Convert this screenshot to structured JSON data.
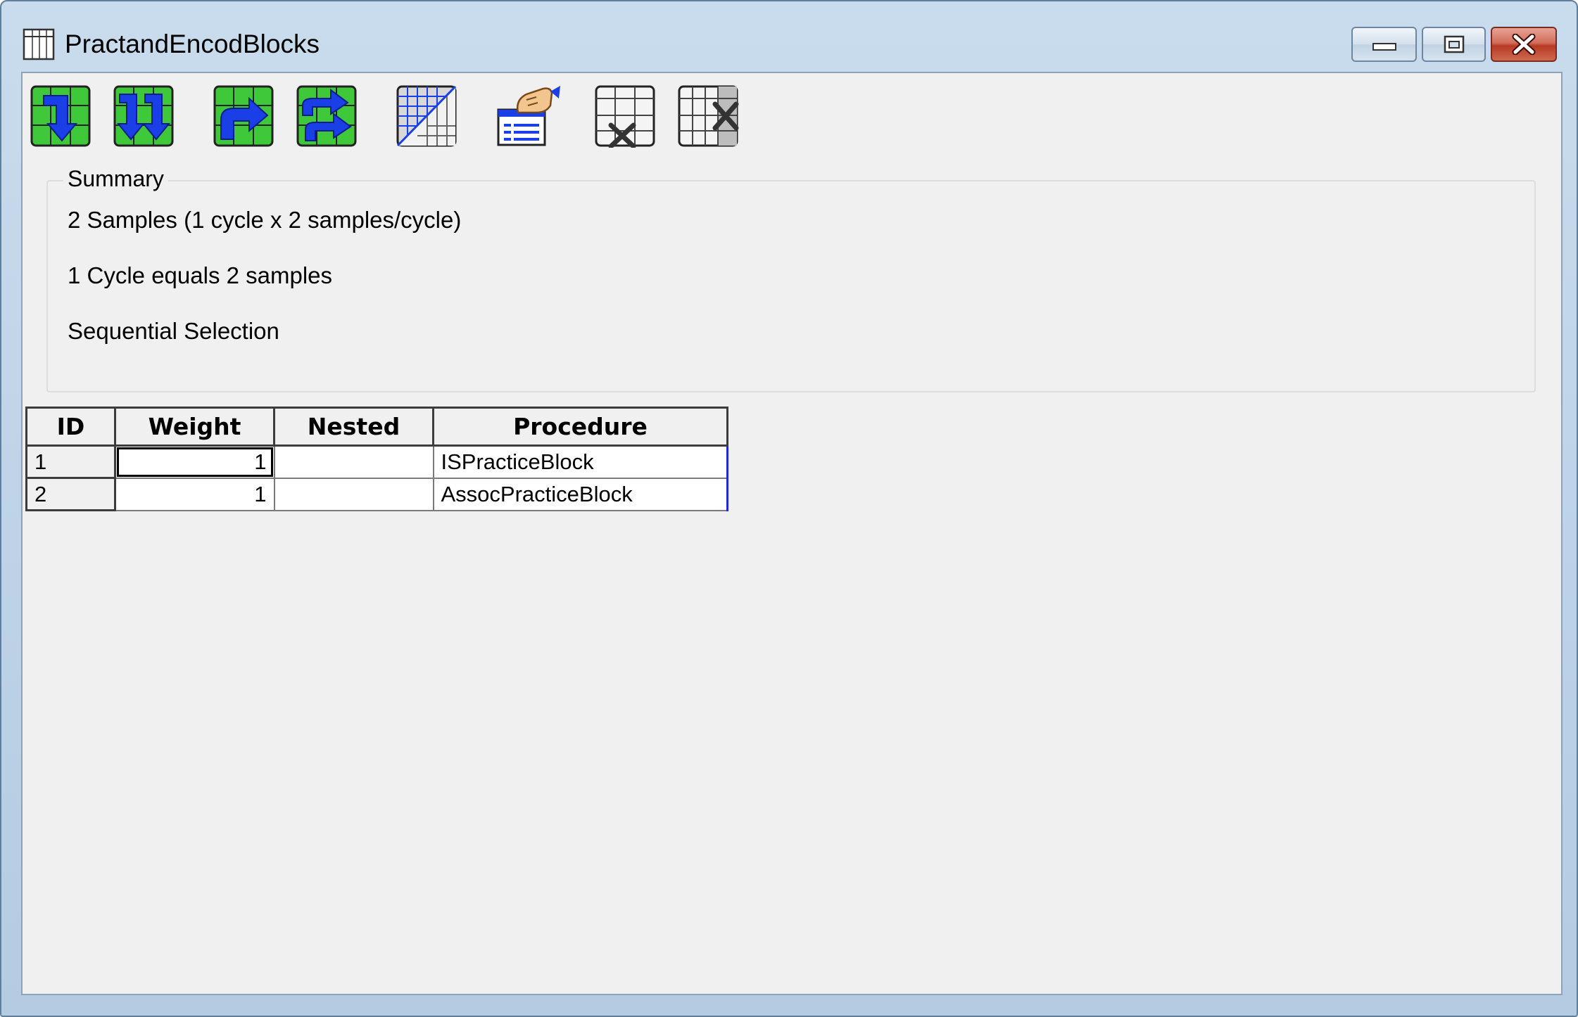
{
  "window": {
    "title": "PractandEncodBlocks",
    "icon": "grid-table-icon",
    "controls": [
      "minimize-icon",
      "restore-icon",
      "close-icon"
    ]
  },
  "toolbar": {
    "buttons": [
      {
        "name": "insert-attribute-before-icon"
      },
      {
        "name": "insert-multiple-attributes-before-icon"
      },
      {
        "name": "insert-attribute-after-icon"
      },
      {
        "name": "insert-multiple-attributes-after-icon"
      },
      {
        "name": "edit-grid-icon"
      },
      {
        "name": "properties-hand-icon"
      },
      {
        "name": "remove-attribute-icon"
      },
      {
        "name": "delete-attribute-icon"
      }
    ]
  },
  "summary": {
    "legend": "Summary",
    "line1": "2 Samples (1 cycle x 2 samples/cycle)",
    "line2": "1 Cycle equals 2 samples",
    "line3": "Sequential Selection"
  },
  "grid": {
    "columns": [
      "ID",
      "Weight",
      "Nested",
      "Procedure"
    ],
    "rows": [
      {
        "id": "1",
        "weight": "1",
        "nested": "",
        "procedure": "ISPracticeBlock"
      },
      {
        "id": "2",
        "weight": "1",
        "nested": "",
        "procedure": "AssocPracticeBlock"
      }
    ]
  },
  "colors": {
    "arrow_blue": "#1a3fe6",
    "grid_green": "#3ec83a",
    "close_red": "#c8432d",
    "selection_blue": "#1d2bd6"
  }
}
